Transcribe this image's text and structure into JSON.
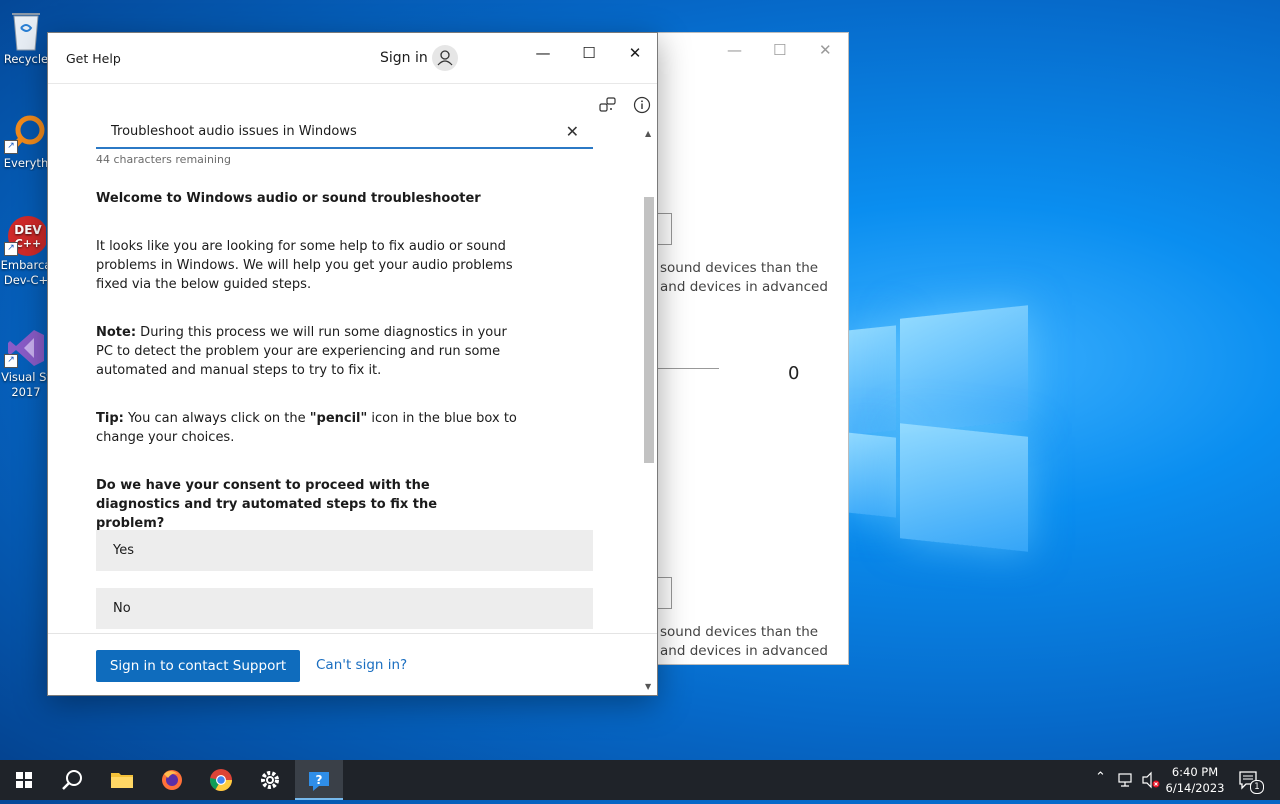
{
  "desktop": {
    "icons": [
      {
        "label": "Recycle",
        "name": "recycle-bin"
      },
      {
        "label": "Everyth",
        "name": "everything"
      },
      {
        "label": "Embarca Dev-C+",
        "name": "dev-cpp"
      },
      {
        "label": "Visual St 2017",
        "name": "visual-studio"
      }
    ]
  },
  "bg_window": {
    "text_a1": "sound devices than the",
    "text_a2": "and devices in advanced",
    "value": "0",
    "text_b1": "sound devices than the",
    "text_b2": "and devices in advanced"
  },
  "window": {
    "title": "Get Help",
    "sign_in": "Sign in"
  },
  "search": {
    "value": "Troubleshoot audio issues in Windows",
    "chars_remaining": "44 characters remaining"
  },
  "content": {
    "heading": "Welcome to Windows audio or sound troubleshooter",
    "para1": "It looks like you are looking for some help to fix audio or sound problems in Windows. We will help you get your audio problems fixed via the below guided steps.",
    "note_label": "Note:",
    "note_text": " During this process we will run some diagnostics in your PC to detect the problem your are experiencing and run some automated  and manual steps to try to fix it.",
    "tip_label": "Tip:",
    "tip_text_1": " You can always click on the ",
    "tip_bold": "\"pencil\"",
    "tip_text_2": " icon in the blue box to change your choices.",
    "question": "Do we have your consent to proceed with the diagnostics and try automated steps to fix the problem?"
  },
  "choices": [
    {
      "label": "Yes"
    },
    {
      "label": "No"
    }
  ],
  "footer": {
    "primary": "Sign in to contact Support",
    "link": "Can't sign in?"
  },
  "taskbar": {
    "time": "6:40 PM",
    "date": "6/14/2023",
    "notification_count": "1"
  },
  "colors": {
    "accent": "#0f6cbd",
    "link": "#1a6ec0",
    "taskbar": "#1f2329"
  }
}
